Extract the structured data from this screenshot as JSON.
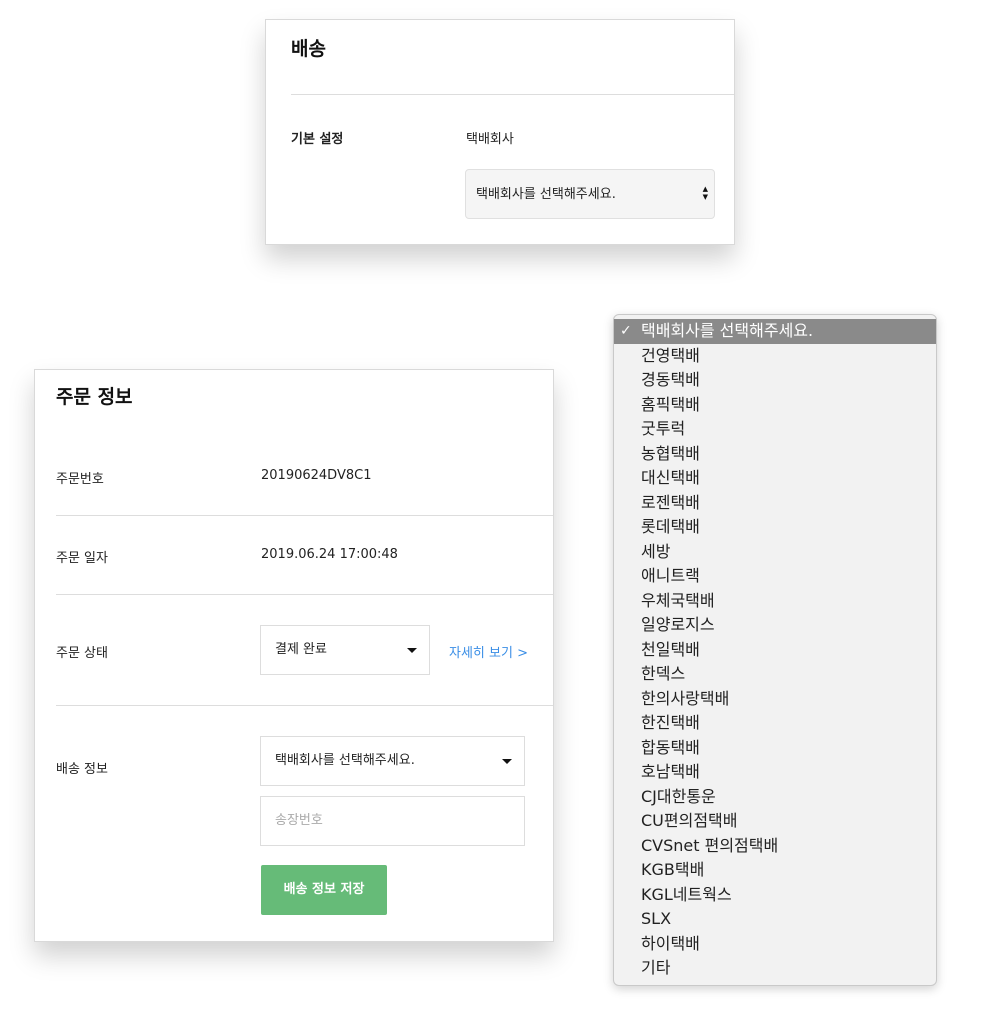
{
  "shipping_settings": {
    "title": "배송",
    "row_label": "기본 설정",
    "field_label": "택배회사",
    "select_value": "택배회사를 선택해주세요."
  },
  "order_info": {
    "title": "주문 정보",
    "order_number_label": "주문번호",
    "order_number": "20190624DV8C1",
    "order_date_label": "주문 일자",
    "order_date": "2019.06.24 17:00:48",
    "order_status_label": "주문 상태",
    "order_status": "결제 완료",
    "details_link": "자세히 보기 >",
    "shipping_label": "배송 정보",
    "courier_select": "택배회사를 선택해주세요.",
    "tracking_placeholder": "송장번호",
    "save_button": "배송 정보 저장"
  },
  "courier_dropdown": {
    "selected_index": 0,
    "options": [
      "택배회사를 선택해주세요.",
      "건영택배",
      "경동택배",
      "홈픽택배",
      "굿투럭",
      "농협택배",
      "대신택배",
      "로젠택배",
      "롯데택배",
      "세방",
      "애니트랙",
      "우체국택배",
      "일양로지스",
      "천일택배",
      "한덱스",
      "한의사랑택배",
      "한진택배",
      "합동택배",
      "호남택배",
      "CJ대한통운",
      "CU편의점택배",
      "CVSnet 편의점택배",
      "KGB택배",
      "KGL네트웍스",
      "SLX",
      "하이택배",
      "기타"
    ]
  },
  "colors": {
    "accent_green": "#66bb78",
    "link_blue": "#3a8ee6",
    "selected_option_bg": "#8a8a8a"
  },
  "icons": {
    "select_arrows": "up-down-arrows-icon",
    "dropdown_caret": "caret-down-icon",
    "selected_check": "checkmark-icon"
  }
}
